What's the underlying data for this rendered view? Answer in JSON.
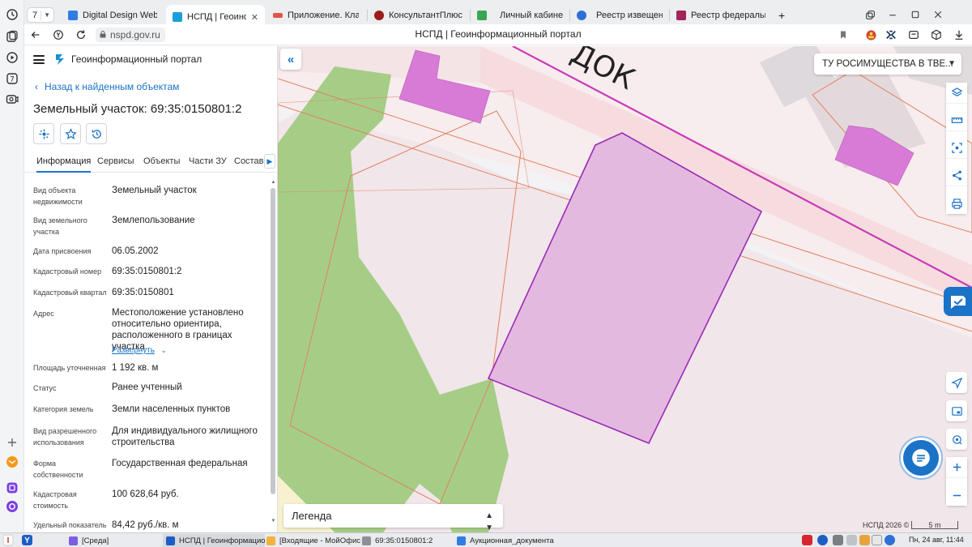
{
  "browser": {
    "tab_count": "7",
    "tabs": [
      {
        "title": "Digital Design Web Client",
        "color": "#2f7de1"
      },
      {
        "title": "НСПД | Геоинформаци",
        "color": "#1aa0d8",
        "active": true
      },
      {
        "title": "Приложение. Классифи",
        "color": "#e5534b"
      },
      {
        "title": "КонсультантПлюс Автори",
        "color": "#9b1c1c"
      },
      {
        "title": "Личный кабинет",
        "color": "#3aa655"
      },
      {
        "title": "Реестр извещений",
        "color": "#2f6fd8"
      },
      {
        "title": "Реестр федерального им",
        "color": "#a3245b"
      }
    ],
    "new_tab": "+",
    "url": "nspd.gov.ru",
    "page_title": "НСПД | Геоинформационный портал"
  },
  "panel": {
    "portal_name": "Геоинформационный портал",
    "back_link": "Назад к найденным объектам",
    "object_title": "Земельный участок: 69:35:0150801:2",
    "tabs": [
      "Информация",
      "Сервисы",
      "Объекты",
      "Части ЗУ",
      "Состав"
    ],
    "fields": [
      {
        "label": "Вид объекта недвижимости",
        "value": "Земельный участок"
      },
      {
        "label": "Вид земельного участка",
        "value": "Землепользование"
      },
      {
        "label": "Дата присвоения",
        "value": "06.05.2002"
      },
      {
        "label": "Кадастровый номер",
        "value": "69:35:0150801:2"
      },
      {
        "label": "Кадастровый квартал",
        "value": "69:35:0150801"
      },
      {
        "label": "Адрес",
        "value": "Местоположение установлено относительно ориентира, расположенного в границах участка."
      },
      {
        "label": "Площадь уточненная",
        "value": "1 192 кв. м"
      },
      {
        "label": "Статус",
        "value": "Ранее учтенный"
      },
      {
        "label": "Категория земель",
        "value": "Земли населенных пунктов"
      },
      {
        "label": "Вид разрешенного использования",
        "value": "Для индивидуального жилищного строительства"
      },
      {
        "label": "Форма собственности",
        "value": "Государственная федеральная"
      },
      {
        "label": "Кадастровая стоимость",
        "value": "100 628,64 руб."
      },
      {
        "label": "Удельный показатель",
        "value": "84,42 руб./кв. м"
      }
    ],
    "expand_link": "Развернуть"
  },
  "map": {
    "org_select": "ТУ РОСИМУЩЕСТВА В ТВЕ...",
    "street_label": "ДОК",
    "legend": "Легенда",
    "copyright": "НСПД 2026 ©",
    "scale": "5 m",
    "colors": {
      "parcel_fill": "#e4b9e0",
      "parcel_stroke": "#9b2bb5",
      "building": "#d77bd6",
      "vegetation": "#9dc97c",
      "road": "#f6e2e4",
      "accent": "#1a73c7"
    }
  },
  "taskbar": {
    "items": [
      {
        "label": "[Среда]"
      },
      {
        "label": "НСПД | Геоинформацио..."
      },
      {
        "label": "[Входящие - МойОфис П..."
      },
      {
        "label": "69:35:0150801:2"
      },
      {
        "label": "Аукционная_документа..."
      }
    ],
    "clock": "Пн, 24 авг, 11:44"
  }
}
